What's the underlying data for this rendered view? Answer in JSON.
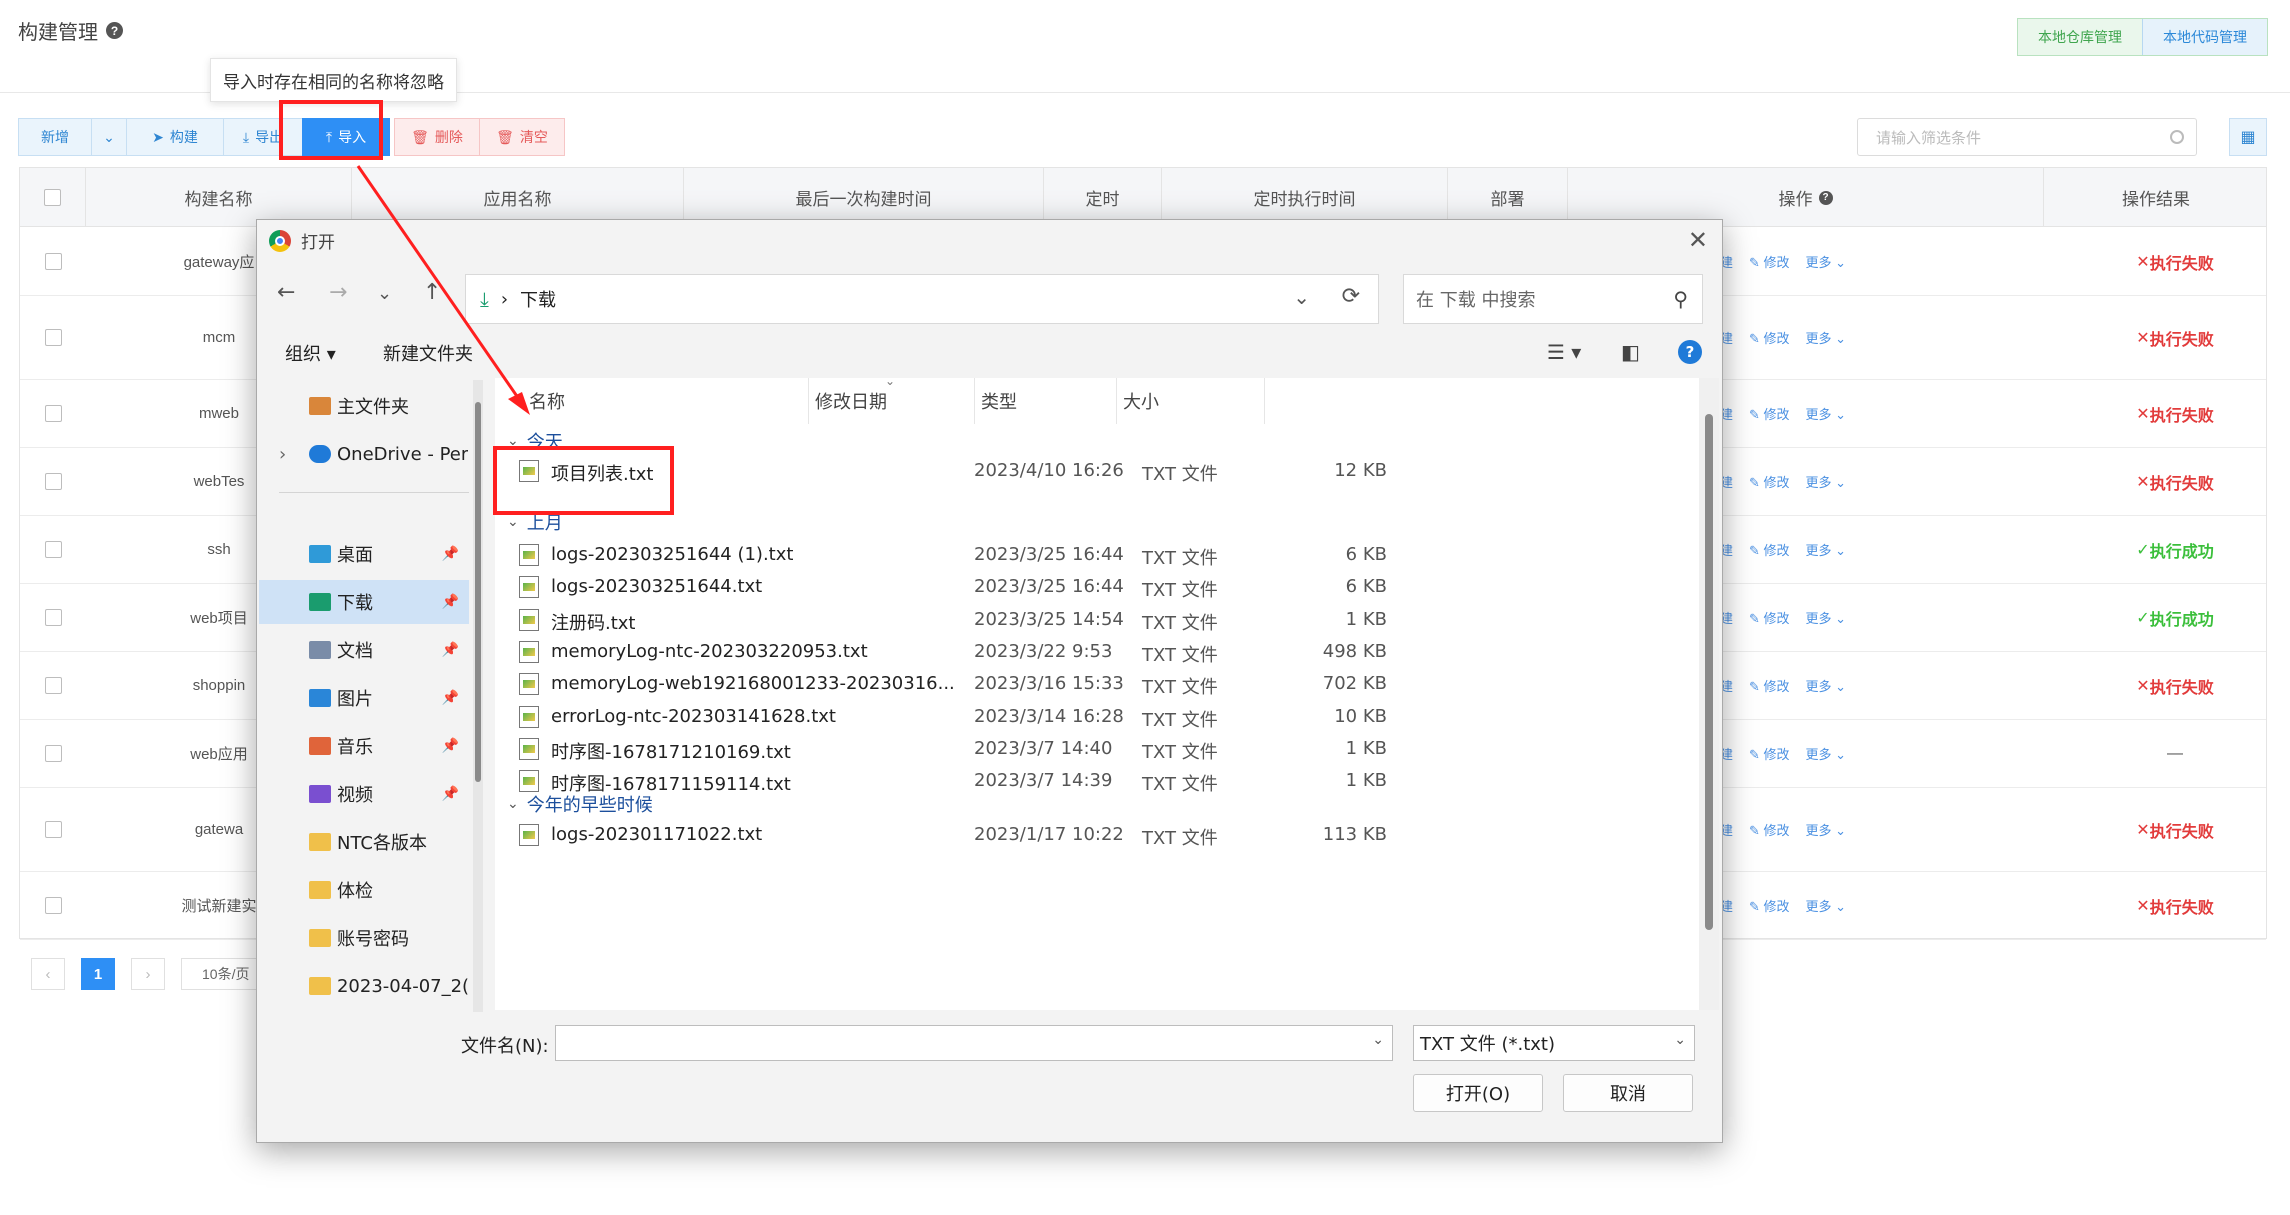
{
  "page": {
    "title": "构建管理",
    "help_glyph": "?",
    "top_buttons": [
      "本地仓库管理",
      "本地代码管理"
    ],
    "tooltip": "导入时存在相同的名称将忽略"
  },
  "toolbar": {
    "add": "新增",
    "build": "构建",
    "export": "导出",
    "import": "导入",
    "delete": "删除",
    "clear": "清空",
    "filter_placeholder": "请输入筛选条件"
  },
  "table": {
    "headers": [
      "构建名称",
      "应用名称",
      "最后一次构建时间",
      "定时",
      "定时执行时间",
      "部署",
      "操作",
      "操作结果"
    ],
    "ops": [
      "建",
      "修改",
      "更多"
    ],
    "rows": [
      {
        "name": "gateway应",
        "result": "执行失败",
        "status": "fail"
      },
      {
        "name": "mcm",
        "result": "执行失败",
        "status": "fail"
      },
      {
        "name": "mweb",
        "result": "执行失败",
        "status": "fail"
      },
      {
        "name": "webTes",
        "result": "执行失败",
        "status": "fail"
      },
      {
        "name": "ssh",
        "result": "执行成功",
        "status": "ok"
      },
      {
        "name": "web项目",
        "result": "执行成功",
        "status": "ok"
      },
      {
        "name": "shoppin",
        "result": "执行失败",
        "status": "fail"
      },
      {
        "name": "web应用",
        "result": "—",
        "status": "none"
      },
      {
        "name": "gatewa",
        "result": "执行失败",
        "status": "fail"
      },
      {
        "name": "测试新建实",
        "result": "执行失败",
        "status": "fail"
      }
    ]
  },
  "pager": {
    "page": "1",
    "size": "10条/页"
  },
  "dialog": {
    "title": "打开",
    "path": "下载",
    "search_placeholder": "在 下载 中搜索",
    "organize": "组织",
    "new_folder": "新建文件夹",
    "nav": [
      {
        "label": "主文件夹",
        "icon": "home-icon",
        "pin": false
      },
      {
        "label": "OneDrive - Per",
        "icon": "onedrive-icon",
        "pin": false
      },
      {
        "label": "桌面",
        "icon": "desktop-icon",
        "pin": true
      },
      {
        "label": "下载",
        "icon": "download-icon",
        "pin": true
      },
      {
        "label": "文档",
        "icon": "document-icon",
        "pin": true
      },
      {
        "label": "图片",
        "icon": "pictures-icon",
        "pin": true
      },
      {
        "label": "音乐",
        "icon": "music-icon",
        "pin": true
      },
      {
        "label": "视频",
        "icon": "video-icon",
        "pin": true
      },
      {
        "label": "NTC各版本",
        "icon": "folder-icon",
        "pin": false
      },
      {
        "label": "体检",
        "icon": "folder-icon",
        "pin": false
      },
      {
        "label": "账号密码",
        "icon": "folder-icon",
        "pin": false
      },
      {
        "label": "2023-04-07_2(",
        "icon": "folder-icon",
        "pin": false
      }
    ],
    "columns": [
      "名称",
      "修改日期",
      "类型",
      "大小"
    ],
    "groups": [
      "今天",
      "上月",
      "今年的早些时候"
    ],
    "files_today": [
      {
        "name": "项目列表.txt",
        "date": "2023/4/10 16:26",
        "type": "TXT 文件",
        "size": "12 KB"
      }
    ],
    "files_last_month": [
      {
        "name": "logs-202303251644 (1).txt",
        "date": "2023/3/25 16:44",
        "type": "TXT 文件",
        "size": "6 KB"
      },
      {
        "name": "logs-202303251644.txt",
        "date": "2023/3/25 16:44",
        "type": "TXT 文件",
        "size": "6 KB"
      },
      {
        "name": "注册码.txt",
        "date": "2023/3/25 14:54",
        "type": "TXT 文件",
        "size": "1 KB"
      },
      {
        "name": "memoryLog-ntc-202303220953.txt",
        "date": "2023/3/22 9:53",
        "type": "TXT 文件",
        "size": "498 KB"
      },
      {
        "name": "memoryLog-web192168001233-20230316...",
        "date": "2023/3/16 15:33",
        "type": "TXT 文件",
        "size": "702 KB"
      },
      {
        "name": "errorLog-ntc-202303141628.txt",
        "date": "2023/3/14 16:28",
        "type": "TXT 文件",
        "size": "10 KB"
      },
      {
        "name": "时序图-1678171210169.txt",
        "date": "2023/3/7 14:40",
        "type": "TXT 文件",
        "size": "1 KB"
      },
      {
        "name": "时序图-1678171159114.txt",
        "date": "2023/3/7 14:39",
        "type": "TXT 文件",
        "size": "1 KB"
      }
    ],
    "files_earlier": [
      {
        "name": "logs-202301171022.txt",
        "date": "2023/1/17 10:22",
        "type": "TXT 文件",
        "size": "113 KB"
      }
    ],
    "filename_label": "文件名(N):",
    "filename_value": "",
    "filetype": "TXT 文件 (*.txt)",
    "open_label": "打开(O)",
    "cancel_label": "取消"
  },
  "colors": {
    "accent": "#2e8ff5",
    "fail": "#e23b3b",
    "ok": "#3bbf3b",
    "highlight": "#ff1f1f"
  }
}
